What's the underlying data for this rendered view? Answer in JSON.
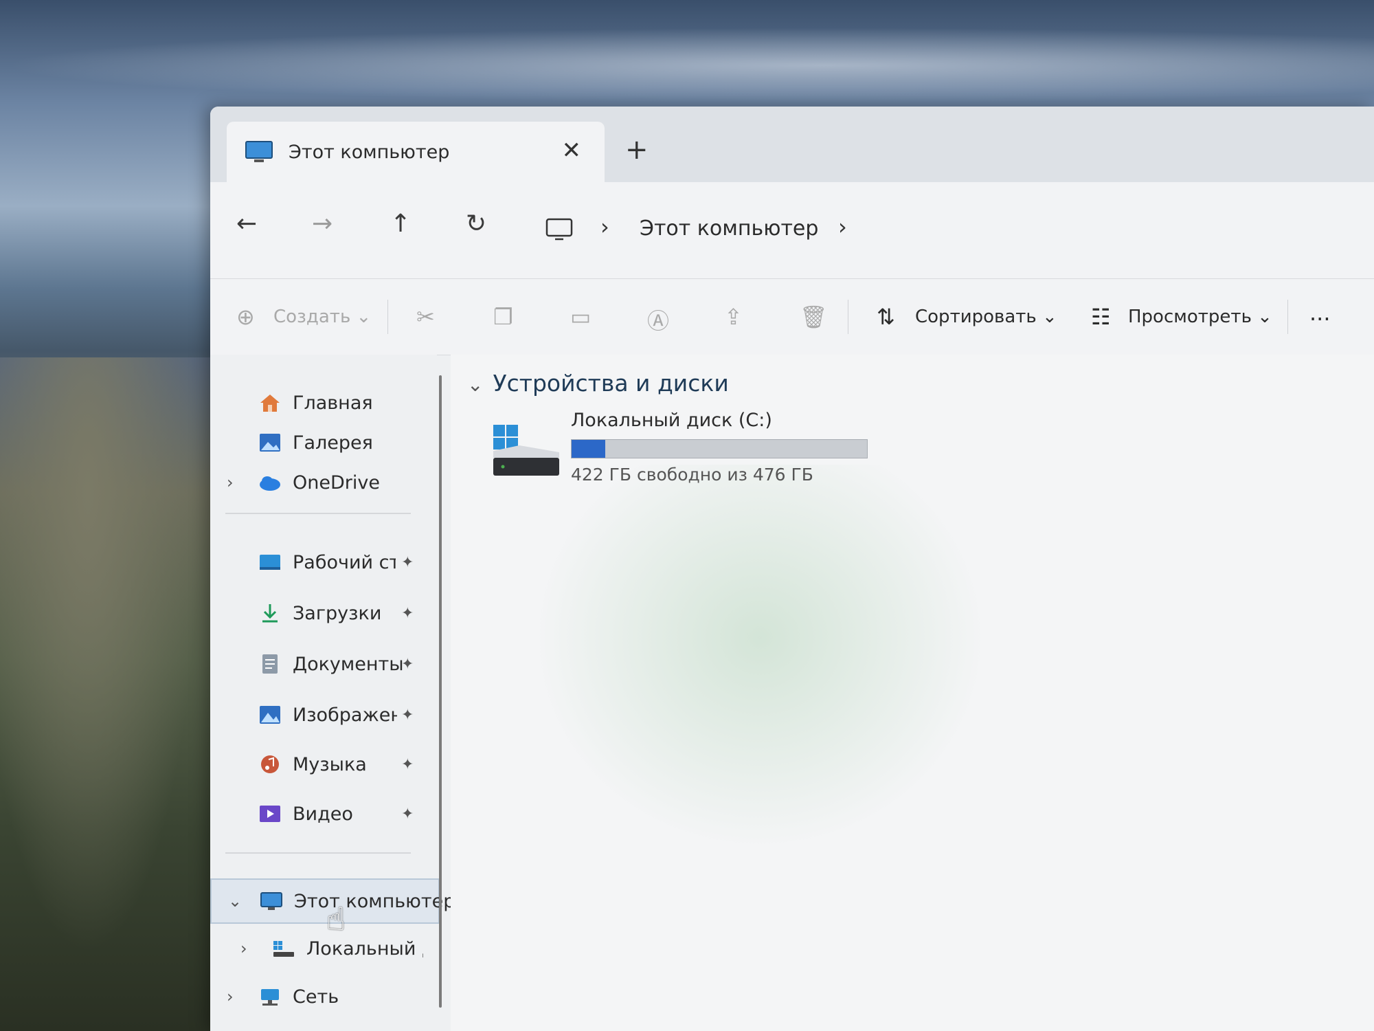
{
  "window": {
    "tab_title": "Этот компьютер",
    "tab_close": "✕",
    "new_tab": "+"
  },
  "nav": {
    "back": "←",
    "forward": "→",
    "up": "↑",
    "refresh": "↻",
    "address_chevron": "›",
    "address_location": "Этот компьютер"
  },
  "toolbar": {
    "create_label": "Создать",
    "sort_label": "Сортировать",
    "view_label": "Просмотреть",
    "more_label": "...",
    "dropdown_glyph": "⌄"
  },
  "sidebar": {
    "items": [
      {
        "label": "Главная",
        "icon": "home-icon"
      },
      {
        "label": "Галерея",
        "icon": "gallery-icon"
      },
      {
        "label": "OneDrive",
        "icon": "onedrive-cloud-icon"
      },
      {
        "label": "Рабочий сто",
        "icon": "desktop-icon",
        "pinned": true
      },
      {
        "label": "Загрузки",
        "icon": "download-icon",
        "pinned": true
      },
      {
        "label": "Документы",
        "icon": "documents-icon",
        "pinned": true
      },
      {
        "label": "Изображени",
        "icon": "pictures-icon",
        "pinned": true
      },
      {
        "label": "Музыка",
        "icon": "music-icon",
        "pinned": true
      },
      {
        "label": "Видео",
        "icon": "video-icon",
        "pinned": true
      },
      {
        "label": "Этот компьютер",
        "icon": "this-pc-icon",
        "selected": true
      },
      {
        "label": "Локальный ди",
        "icon": "local-disk-icon"
      },
      {
        "label": "Сеть",
        "icon": "network-icon"
      }
    ],
    "pin_glyph": "📌",
    "expand_chevron": "›",
    "collapse_chevron": "⌄"
  },
  "content": {
    "group_header": "Устройства и диски",
    "drive": {
      "name": "Локальный диск (C:)",
      "free_text": "422 ГБ свободно из 476 ГБ",
      "used_fraction": 0.113
    }
  },
  "colors": {
    "accent": "#2c68c8",
    "window_bg": "#eef0f2"
  }
}
